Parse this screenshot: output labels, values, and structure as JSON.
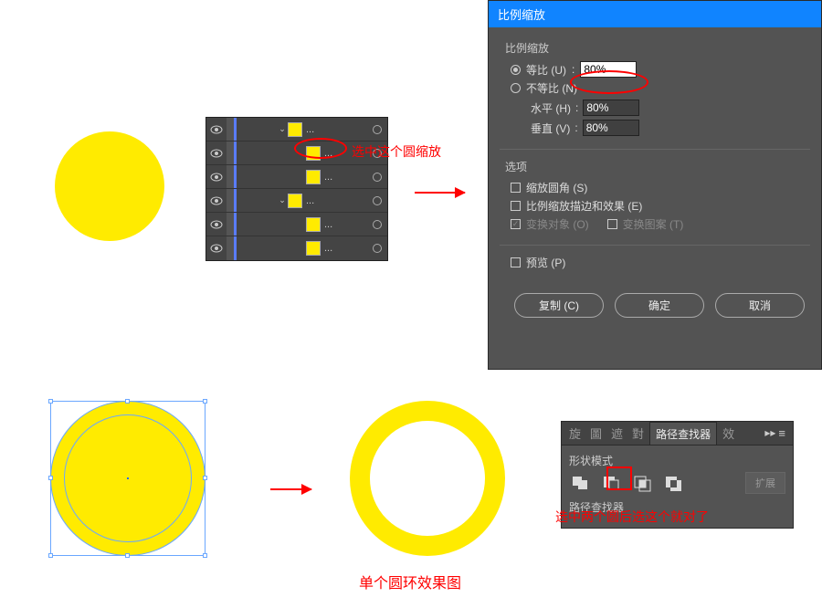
{
  "top": {
    "annot_select_scale": "选中这个圆缩放"
  },
  "layers": {
    "rows": [
      {
        "indent": 0,
        "twisty": "⌄",
        "label": "..."
      },
      {
        "indent": 1,
        "twisty": "",
        "label": "..."
      },
      {
        "indent": 1,
        "twisty": "",
        "label": "..."
      },
      {
        "indent": 0,
        "twisty": "⌄",
        "label": "..."
      },
      {
        "indent": 1,
        "twisty": "",
        "label": "..."
      },
      {
        "indent": 1,
        "twisty": "",
        "label": "..."
      }
    ]
  },
  "dialog": {
    "title": "比例缩放",
    "group1_label": "比例缩放",
    "radio_uniform": "等比 (U)",
    "radio_nonuniform": "不等比 (N)",
    "uniform_value": "80%",
    "horiz_label": "水平 (H)",
    "horiz_value": "80%",
    "vert_label": "垂直 (V)",
    "vert_value": "80%",
    "options_label": "选项",
    "opt_scale_corners": "缩放圆角 (S)",
    "opt_scale_strokes": "比例缩放描边和效果 (E)",
    "opt_transform_obj": "变换对象 (O)",
    "opt_transform_pat": "变换图案 (T)",
    "preview": "预览 (P)",
    "btn_copy": "复制 (C)",
    "btn_ok": "确定",
    "btn_cancel": "取消"
  },
  "bottom": {
    "ring_caption": "单个圆环效果图",
    "pathfinder_annot": "选中两个圆后选这个就对了"
  },
  "pathfinder": {
    "tabs_glyphs": [
      "旋",
      "圖",
      "遮",
      "對"
    ],
    "tab_active": "路径查找器",
    "tab_right": "效",
    "shape_modes_label": "形状模式",
    "expand_label": "扩展",
    "pathfinders_label": "路径查找器"
  }
}
